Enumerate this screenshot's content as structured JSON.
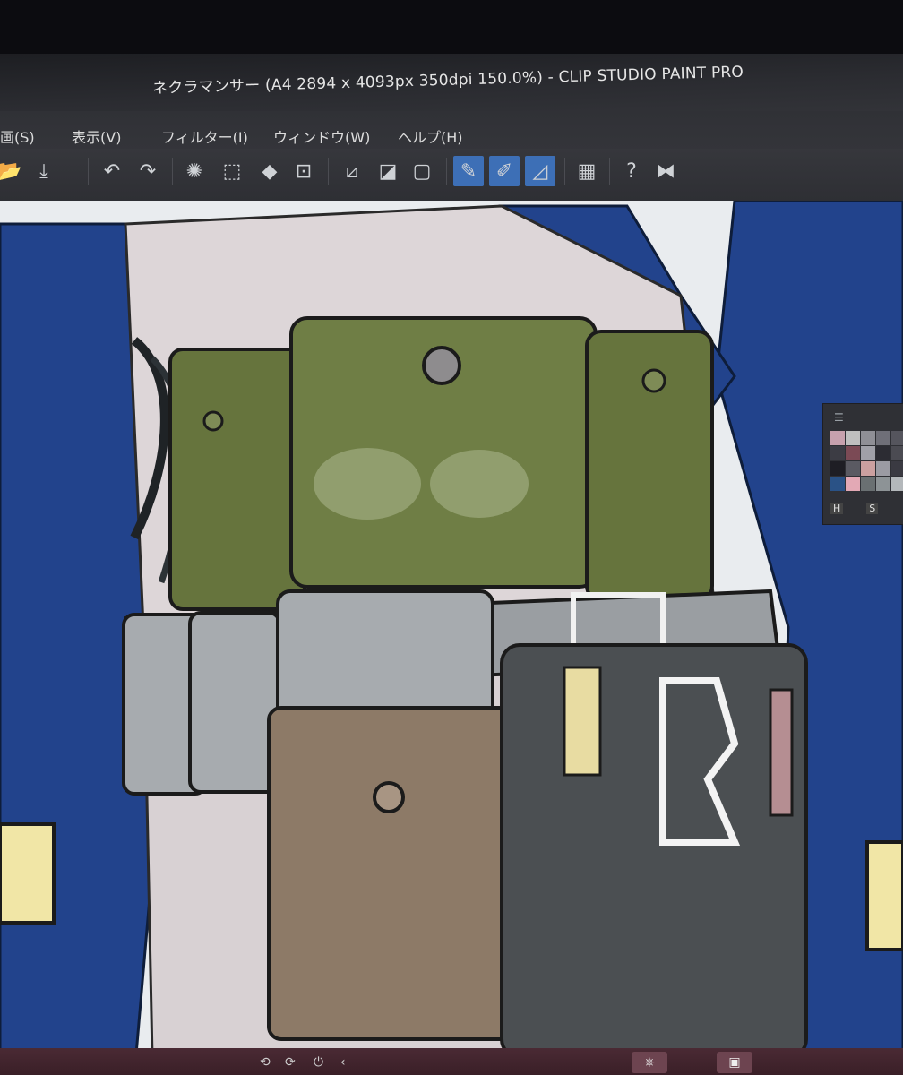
{
  "window": {
    "title": "ネクラマンサー (A4 2894 x 4093px 350dpi 150.0%)  - CLIP STUDIO PAINT PRO"
  },
  "menubar": {
    "items": [
      {
        "label": "画(S)"
      },
      {
        "label": "表示(V)"
      },
      {
        "label": "フィルター(I)"
      },
      {
        "label": "ウィンドウ(W)"
      },
      {
        "label": "ヘルプ(H)"
      }
    ]
  },
  "toolbar": {
    "icons": [
      "folder-icon",
      "save-icon",
      "undo-icon",
      "redo-icon",
      "clear-selection-icon",
      "selection-icon",
      "fill-icon",
      "transform-icon",
      "deselect-icon",
      "invert-selection-icon",
      "show-selection-icon",
      "pen-stabilization-icon",
      "brush-stabilization-icon",
      "ruler-icon",
      "device-icon",
      "help-icon",
      "flip-icon"
    ]
  },
  "palette": {
    "title_icon": "menu-icon",
    "keys": [
      "H",
      "S"
    ],
    "swatches": [
      "#c7a1ae",
      "#bfbfbf",
      "#8f8f96",
      "#6f6f78",
      "#55555d",
      "#3c3c44",
      "#7b4a55",
      "#a0a0a8",
      "#2c2c33",
      "#4b4b52",
      "#1e1e24",
      "#5a5a62",
      "#cba0a0",
      "#9b9ba3",
      "#3a3a42",
      "#2a5286",
      "#e3a9b5",
      "#6a7072",
      "#8d9396",
      "#b4b8bb"
    ]
  },
  "taskbar": {
    "icons": [
      "prev-icon",
      "next-icon",
      "power-icon",
      "chevron-left-icon",
      "app-icon",
      "cube-icon"
    ]
  },
  "colors": {
    "navy": "#22438c",
    "olive": "#66743d",
    "gray_pouch": "#a7abaf",
    "brown_pouch": "#8d7a67",
    "dark_gear": "#4b4f52",
    "shirt": "#ddd6d8",
    "accent_blue": "#3d6fb6"
  }
}
